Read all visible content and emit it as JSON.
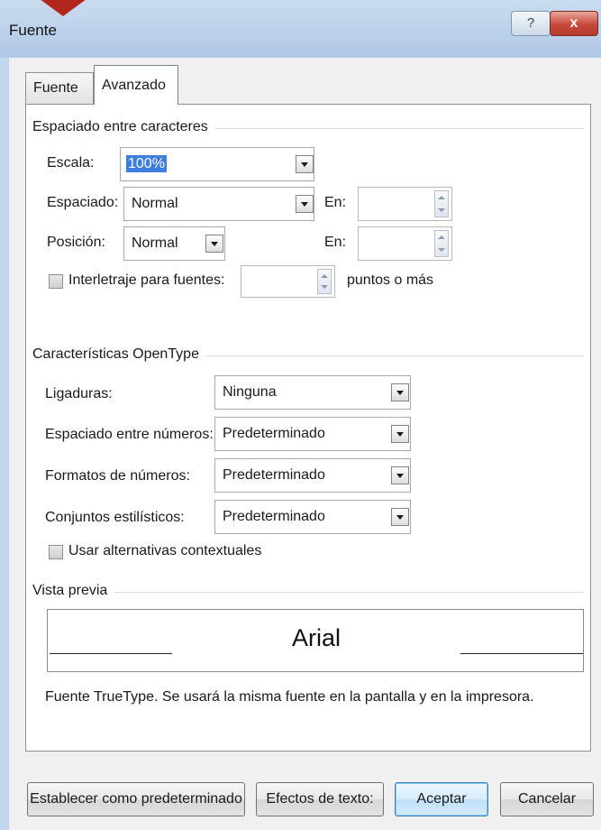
{
  "window": {
    "title": "Fuente",
    "help_label": "?",
    "close_label": "x"
  },
  "tabs": [
    {
      "label": "Fuente",
      "active": false
    },
    {
      "label": "Avanzado",
      "active": true
    }
  ],
  "character_spacing": {
    "section_title": "Espaciado entre caracteres",
    "scale_label": "Escala:",
    "scale_value": "100%",
    "spacing_label": "Espaciado:",
    "spacing_value": "Normal",
    "spacing_by_label": "En:",
    "spacing_by_value": "",
    "position_label": "Posición:",
    "position_value": "Normal",
    "position_by_label": "En:",
    "position_by_value": "",
    "kerning_label": "Interletraje para fuentes:",
    "kerning_checked": false,
    "kerning_value": "",
    "kerning_suffix": "puntos o más"
  },
  "opentype": {
    "section_title": "Características OpenType",
    "ligatures_label": "Ligaduras:",
    "ligatures_value": "Ninguna",
    "number_spacing_label": "Espaciado entre números:",
    "number_spacing_value": "Predeterminado",
    "number_forms_label": "Formatos de números:",
    "number_forms_value": "Predeterminado",
    "stylistic_sets_label": "Conjuntos estilísticos:",
    "stylistic_sets_value": "Predeterminado",
    "contextual_alternates_label": "Usar alternativas contextuales",
    "contextual_alternates_checked": false
  },
  "preview": {
    "section_title": "Vista previa",
    "font_name": "Arial",
    "description": "Fuente TrueType. Se usará la misma fuente en la pantalla y en la impresora."
  },
  "buttons": {
    "set_default": "Establecer como predeterminado",
    "text_effects": "Efectos de texto:",
    "ok": "Aceptar",
    "cancel": "Cancelar"
  },
  "colors": {
    "title_bar": "#bcd1ea",
    "close_button": "#c64a3b",
    "selection": "#3d7ee0",
    "default_button_border": "#3c7fb1"
  }
}
